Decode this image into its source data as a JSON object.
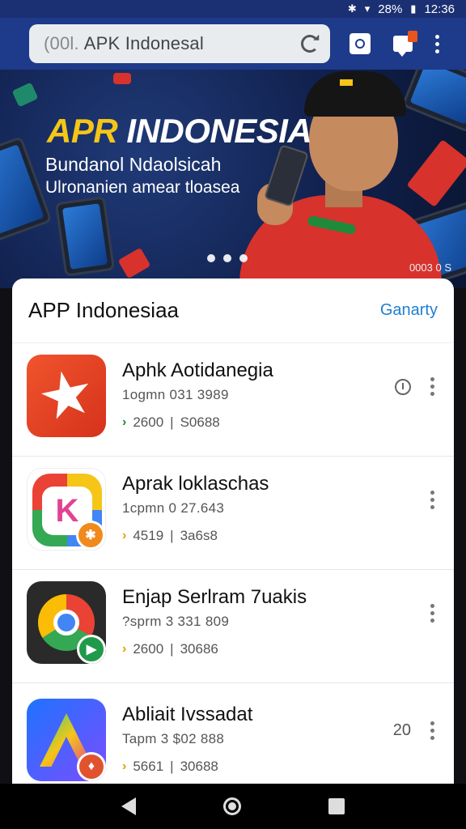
{
  "status_bar": {
    "battery": "28%",
    "time": "12:36"
  },
  "search": {
    "prefix": "(00l.",
    "text": "APK Indonesal"
  },
  "banner": {
    "title_part1": "APR",
    "title_part2": "INDONESIA",
    "subtitle_line1": "Bundanol Ndaolsicah",
    "subtitle_line2": "Ulronanien amear tloasea",
    "caption": "0003 0  S",
    "page_count": 3
  },
  "list_header": {
    "title": "APP Indonesiaa",
    "link": "Ganarty"
  },
  "apps": [
    {
      "name": "Aphk Aotidanegia",
      "meta": "1ogmn 031 3989",
      "stat1": "2600",
      "stat2": "S0688",
      "chevron_color": "#1b8a3a",
      "badge": "",
      "right_count": ""
    },
    {
      "name": "Aprak loklaschas",
      "meta": "1cpmn 0 27.643",
      "stat1": "4519",
      "stat2": "3a6s8",
      "chevron_color": "#e0a100",
      "badge": "✱",
      "right_count": ""
    },
    {
      "name": "Enjap Serlram 7uakis",
      "meta": "?sprm 3 331 809",
      "stat1": "2600",
      "stat2": "30686",
      "chevron_color": "#e0a100",
      "badge": "▶",
      "right_count": ""
    },
    {
      "name": "Abliait Ivssadat",
      "meta": "Tapm 3 $02 888",
      "stat1": "5661",
      "stat2": "30688",
      "chevron_color": "#e0a100",
      "badge": "♦",
      "right_count": "20"
    }
  ],
  "colors": {
    "appbar": "#1e3a8a",
    "banner_accent": "#f5c518",
    "link": "#1e7fd0"
  },
  "icons": [
    "back-icon",
    "home-icon",
    "recents-icon",
    "reload-icon",
    "tab-switcher-icon",
    "notification-icon",
    "overflow-menu-icon",
    "info-icon"
  ]
}
